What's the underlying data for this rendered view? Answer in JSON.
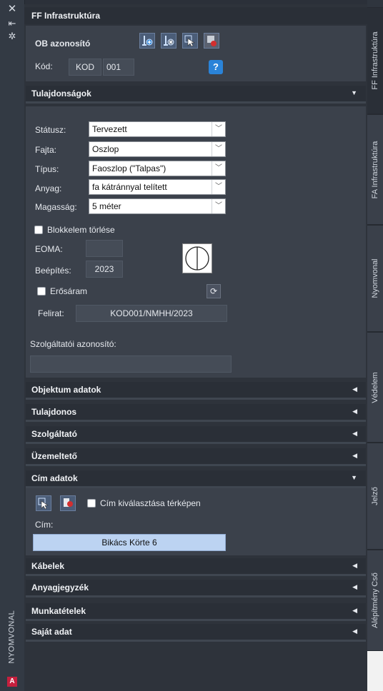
{
  "left_strip": {
    "icons": [
      "close-icon",
      "pin-icon",
      "settings-icon"
    ],
    "vertical_label": "NYOMVONAL",
    "logo": "A"
  },
  "title": "FF Infrastruktúra",
  "ob": {
    "label": "OB azonosító",
    "kod_label": "Kód:",
    "kod_prefix": "KOD",
    "kod_number": "001",
    "help": "?"
  },
  "sections": {
    "tulajdonsagok": "Tulajdonságok",
    "objektum_adatok": "Objektum adatok",
    "tulajdonos": "Tulajdonos",
    "szolgaltato": "Szolgáltató",
    "uzemelteto": "Üzemeltető",
    "cim_adatok": "Cím adatok",
    "kabelek": "Kábelek",
    "anyagjegyzek": "Anyagjegyzék",
    "munkatetelek": "Munkatételek",
    "sajat_adat": "Saját adat"
  },
  "props": {
    "statusz_label": "Státusz:",
    "statusz_value": "Tervezett",
    "fajta_label": "Fajta:",
    "fajta_value": "Oszlop",
    "tipus_label": "Típus:",
    "tipus_value": "Faoszlop (\"Talpas\")",
    "anyag_label": "Anyag:",
    "anyag_value": "fa kátránnyal telített",
    "magassag_label": "Magasság:",
    "magassag_value": "5 méter",
    "blokkelem_label": "Blokkelem törlése",
    "eoma_label": "EOMA:",
    "eoma_value": "",
    "beepites_label": "Beépítés:",
    "beepites_value": "2023",
    "erosaram_label": "Erősáram",
    "felirat_label": "Felirat:",
    "felirat_value": "KOD001/NMHH/2023",
    "szolg_label": "Szolgáltatói azonosító:",
    "szolg_value": ""
  },
  "cim": {
    "checkbox_label": "Cím kiválasztása térképen",
    "cim_label": "Cím:",
    "cim_value": "Bikács Körte  6"
  },
  "right_tabs": [
    "FF Infrastruktúra",
    "FA Infrastruktúra",
    "Nyomvonal",
    "Védelem",
    "Jelző",
    "Alépítmény Cső"
  ],
  "colors": {
    "panel_bg": "#2e333b",
    "section_bg": "#3b414b",
    "accent_blue": "#2a83d8",
    "cim_field": "#bcd3f2"
  }
}
